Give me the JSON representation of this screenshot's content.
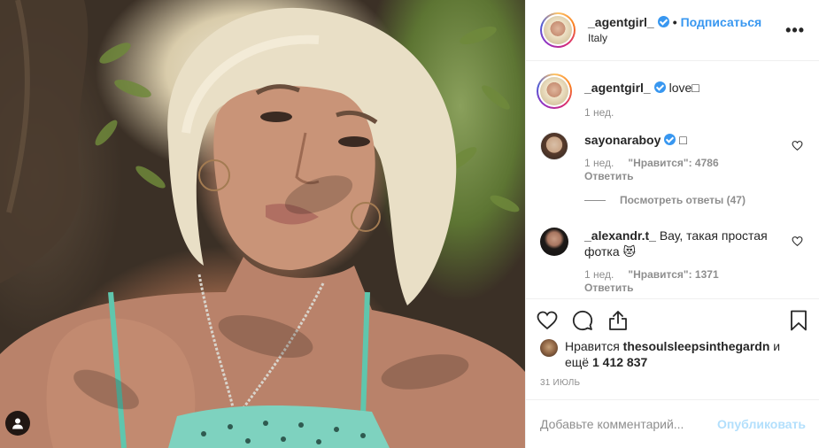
{
  "post": {
    "author": {
      "username": "_agentgirl_",
      "verified": true,
      "follow_label": "Подписаться",
      "dot": "•",
      "location": "Italy",
      "more_label": "•••"
    },
    "caption": {
      "username": "_agentgirl_",
      "text": "love□",
      "time": "1 нед."
    },
    "comments": [
      {
        "username": "sayonaraboy",
        "verified": true,
        "text": "□",
        "time": "1 нед.",
        "likes": "\"Нравится\": 4786",
        "reply_label": "Ответить",
        "view_replies": "Посмотреть ответы (47)"
      },
      {
        "username": "_alexandr.t_",
        "verified": false,
        "text": "Вау, такая простая фотка 😻",
        "time": "1 нед.",
        "likes": "\"Нравится\": 1371",
        "reply_label": "Ответить"
      }
    ],
    "liked_by": {
      "prefix": "Нравится",
      "user": "thesoulsleepsinthegardn",
      "conj": "и",
      "more_prefix": "ещё",
      "count": "1 412 837"
    },
    "date": "31 июль",
    "add_comment": {
      "placeholder": "Добавьте комментарий...",
      "publish_label": "Опубликовать"
    },
    "colors": {
      "accent": "#3897f0",
      "publish_disabled": "#b2dffc",
      "muted": "#8e8e8e",
      "text": "#262626",
      "border": "#efefef"
    },
    "icons": [
      "user-tag-icon",
      "verified-badge-icon",
      "more-options-icon",
      "heart-outline-icon",
      "comment-icon",
      "share-icon",
      "bookmark-icon"
    ]
  }
}
